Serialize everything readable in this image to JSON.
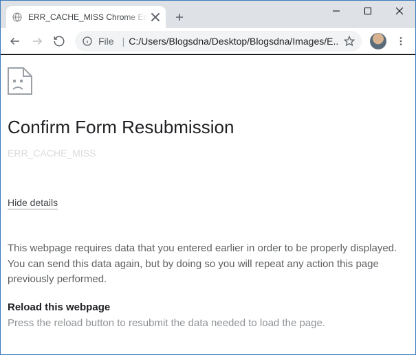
{
  "window": {
    "tab_title": "ERR_CACHE_MISS Chrome Error"
  },
  "toolbar": {
    "url_prefix": "File",
    "url_path": "C:/Users/Blogsdna/Desktop/Blogsdna/Images/E..."
  },
  "page": {
    "title": "Confirm Form Resubmission",
    "error_code": "ERR_CACHE_MISS",
    "hide_details": "Hide details",
    "details_para": "This webpage requires data that you entered earlier in order to be properly displayed. You can send this data again, but by doing so you will repeat any action this page previously performed.",
    "reload_heading": "Reload this webpage",
    "reload_para": "Press the reload button to resubmit the data needed to load the page."
  }
}
